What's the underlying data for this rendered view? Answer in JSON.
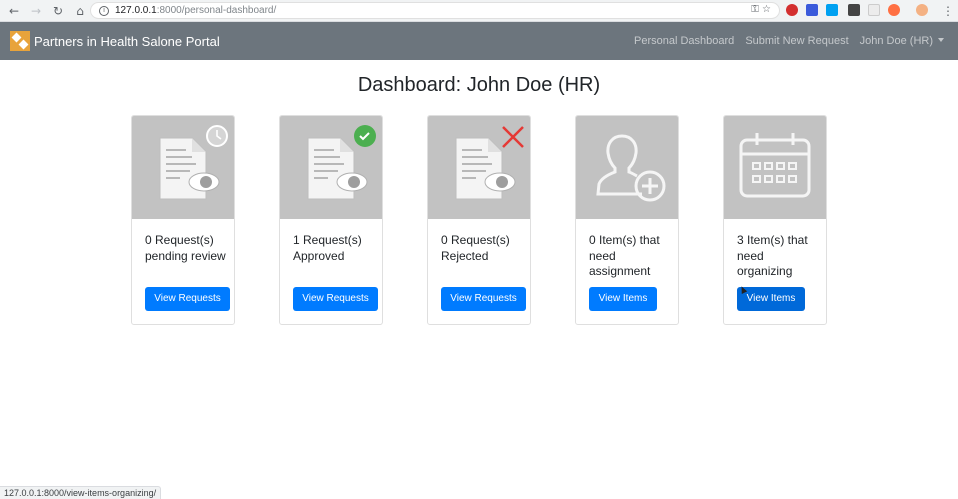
{
  "browser": {
    "url_host": "127.0.0.1",
    "url_path": ":8000/personal-dashboard/"
  },
  "navbar": {
    "brand": "Partners in Health Salone Portal",
    "links": [
      "Personal Dashboard",
      "Submit New Request"
    ],
    "user_menu": "John Doe (HR)"
  },
  "page": {
    "title": "Dashboard: John Doe (HR)"
  },
  "cards": [
    {
      "text": "0 Request(s) pending review",
      "button": "View Requests",
      "icon": "document-clock-icon"
    },
    {
      "text": "1 Request(s) Approved",
      "button": "View Requests",
      "icon": "document-check-icon"
    },
    {
      "text": "0 Request(s) Rejected",
      "button": "View Requests",
      "icon": "document-x-icon"
    },
    {
      "text": "0 Item(s) that need assignment",
      "button": "View Items",
      "icon": "user-add-icon"
    },
    {
      "text": "3 Item(s) that need organizing",
      "button": "View Items",
      "icon": "calendar-icon"
    }
  ],
  "status_bar": {
    "url": "127.0.0.1:8000/view-items-organizing/"
  },
  "colors": {
    "navbar": "#6c757d",
    "primary": "#007bff",
    "approved_badge": "#4caf50",
    "rejected_mark": "#e53935"
  }
}
